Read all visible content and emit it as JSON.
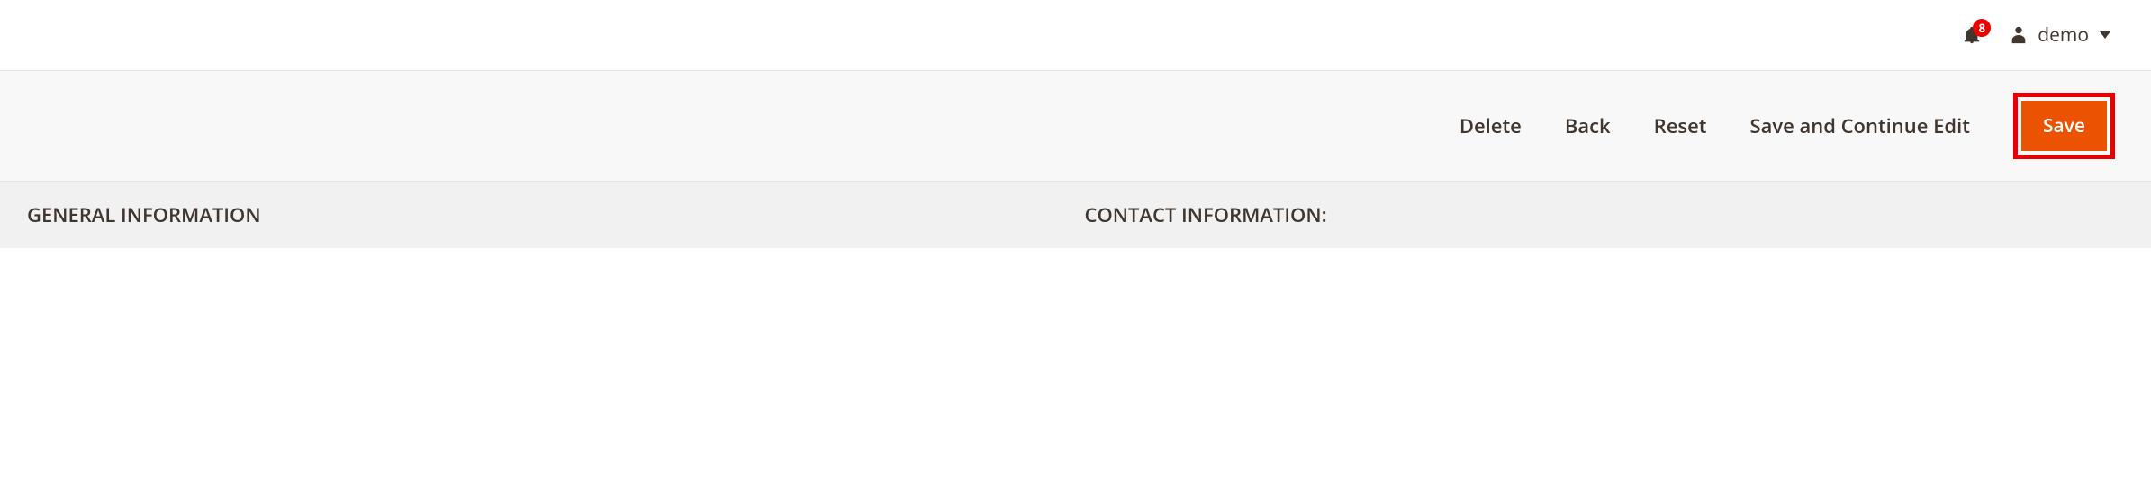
{
  "header": {
    "notification_count": "8",
    "username": "demo"
  },
  "action_bar": {
    "delete_label": "Delete",
    "back_label": "Back",
    "reset_label": "Reset",
    "save_continue_label": "Save and Continue Edit",
    "save_label": "Save"
  },
  "sections": {
    "general_label": "GENERAL INFORMATION",
    "contact_label": "CONTACT INFORMATION:"
  }
}
